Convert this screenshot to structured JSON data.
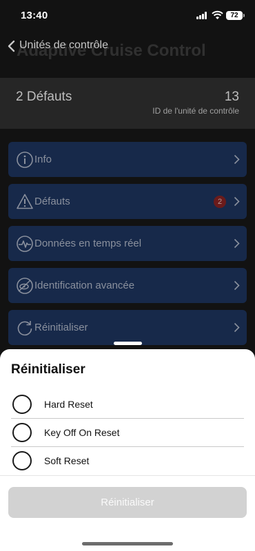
{
  "status_bar": {
    "time": "13:40",
    "battery": "72"
  },
  "nav": {
    "back_label": "Unités de contrôle",
    "title": "Adaptive Cruise Control"
  },
  "summary": {
    "faults": "2 Défauts",
    "unit_id": "13",
    "unit_id_label": "ID de l'unité de contrôle"
  },
  "menu": {
    "items": [
      {
        "label": "Info",
        "icon": "info-icon"
      },
      {
        "label": "Défauts",
        "icon": "warning-icon",
        "badge": "2"
      },
      {
        "label": "Données en temps réel",
        "icon": "live-data-icon"
      },
      {
        "label": "Identification avancée",
        "icon": "identification-icon"
      },
      {
        "label": "Réinitialiser",
        "icon": "reset-icon"
      }
    ]
  },
  "sheet": {
    "title": "Réinitialiser",
    "options": [
      {
        "label": "Hard Reset",
        "selected": false
      },
      {
        "label": "Key Off On Reset",
        "selected": false
      },
      {
        "label": "Soft Reset",
        "selected": false
      }
    ],
    "button_label": "Réinitialiser",
    "button_enabled": false
  },
  "colors": {
    "menu_bg": "#17294a",
    "badge": "#6b1b1b",
    "button_disabled": "#d2d2d2"
  }
}
